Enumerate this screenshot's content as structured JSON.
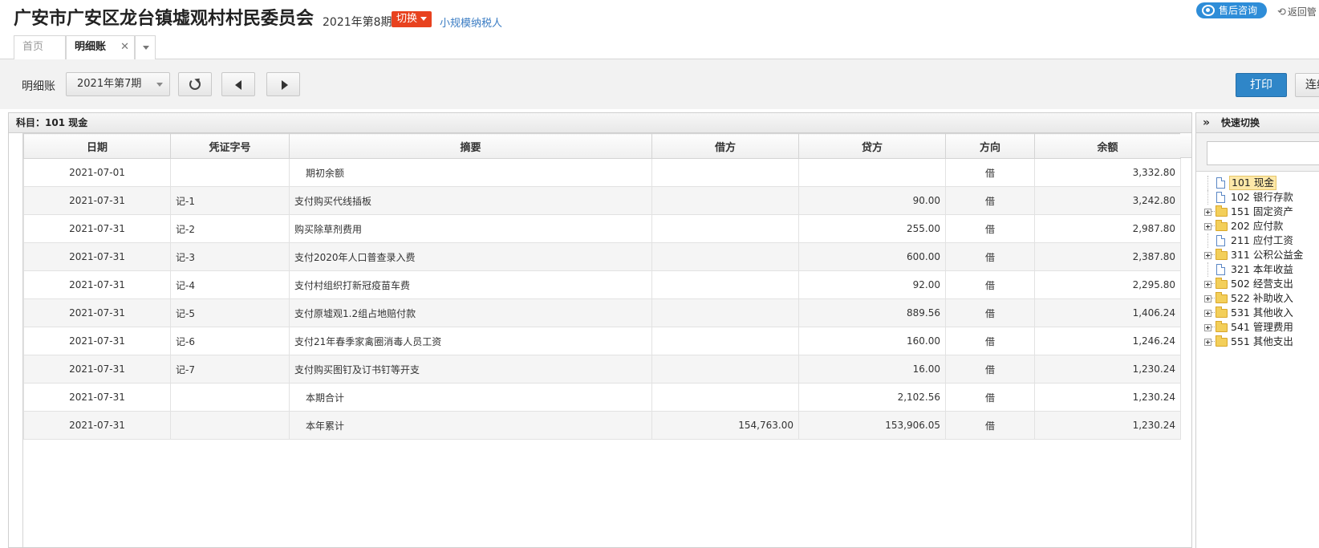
{
  "header": {
    "company": "广安市广安区龙台镇墟观村村民委员会",
    "period": "2021年第8期",
    "switch_label": "切换",
    "taxpayer": "小规模纳税人",
    "support_label": "售后咨询",
    "back_label": "返回管"
  },
  "tabs": [
    {
      "label": "首页"
    },
    {
      "label": "明细账"
    }
  ],
  "toolbar": {
    "label": "明细账",
    "period_value": "2021年第7期",
    "print_label": "打印",
    "continue_label": "连续"
  },
  "ledger": {
    "subject": "科目：101  现金",
    "columns": [
      "日期",
      "凭证字号",
      "摘要",
      "借方",
      "贷方",
      "方向",
      "余额"
    ],
    "rows": [
      {
        "date": "2021-07-01",
        "voucher": "",
        "summary": "期初余额",
        "debit": "",
        "credit": "",
        "dir": "借",
        "balance": "3,332.80"
      },
      {
        "date": "2021-07-31",
        "voucher": "记-1",
        "summary": "支付购买代线插板",
        "debit": "",
        "credit": "90.00",
        "dir": "借",
        "balance": "3,242.80"
      },
      {
        "date": "2021-07-31",
        "voucher": "记-2",
        "summary": "购买除草剂费用",
        "debit": "",
        "credit": "255.00",
        "dir": "借",
        "balance": "2,987.80"
      },
      {
        "date": "2021-07-31",
        "voucher": "记-3",
        "summary": "支付2020年人口普查录入费",
        "debit": "",
        "credit": "600.00",
        "dir": "借",
        "balance": "2,387.80"
      },
      {
        "date": "2021-07-31",
        "voucher": "记-4",
        "summary": "支付村组织打新冠疫苗车费",
        "debit": "",
        "credit": "92.00",
        "dir": "借",
        "balance": "2,295.80"
      },
      {
        "date": "2021-07-31",
        "voucher": "记-5",
        "summary": "支付原墟观1.2组占地赔付款",
        "debit": "",
        "credit": "889.56",
        "dir": "借",
        "balance": "1,406.24"
      },
      {
        "date": "2021-07-31",
        "voucher": "记-6",
        "summary": "支付21年春季家禽圈消毒人员工资",
        "debit": "",
        "credit": "160.00",
        "dir": "借",
        "balance": "1,246.24"
      },
      {
        "date": "2021-07-31",
        "voucher": "记-7",
        "summary": "支付购买图钉及订书钉等开支",
        "debit": "",
        "credit": "16.00",
        "dir": "借",
        "balance": "1,230.24"
      },
      {
        "date": "2021-07-31",
        "voucher": "",
        "summary": "本期合计",
        "debit": "",
        "credit": "2,102.56",
        "dir": "借",
        "balance": "1,230.24"
      },
      {
        "date": "2021-07-31",
        "voucher": "",
        "summary": "本年累计",
        "debit": "154,763.00",
        "credit": "153,906.05",
        "dir": "借",
        "balance": "1,230.24"
      }
    ]
  },
  "quick_switch": {
    "title": "快速切换",
    "search_placeholder": "",
    "items": [
      {
        "label": "101 现金",
        "type": "file",
        "selected": true
      },
      {
        "label": "102 银行存款",
        "type": "file"
      },
      {
        "label": "151 固定资产",
        "type": "folder"
      },
      {
        "label": "202 应付款",
        "type": "folder"
      },
      {
        "label": "211 应付工资",
        "type": "file"
      },
      {
        "label": "311 公积公益金",
        "type": "folder"
      },
      {
        "label": "321 本年收益",
        "type": "file"
      },
      {
        "label": "502 经营支出",
        "type": "folder"
      },
      {
        "label": "522 补助收入",
        "type": "folder"
      },
      {
        "label": "531 其他收入",
        "type": "folder"
      },
      {
        "label": "541 管理费用",
        "type": "folder"
      },
      {
        "label": "551 其他支出",
        "type": "folder"
      }
    ]
  },
  "colors": {
    "accent": "#2f86c8",
    "switch": "#e8421f",
    "link": "#3a7cc3"
  }
}
